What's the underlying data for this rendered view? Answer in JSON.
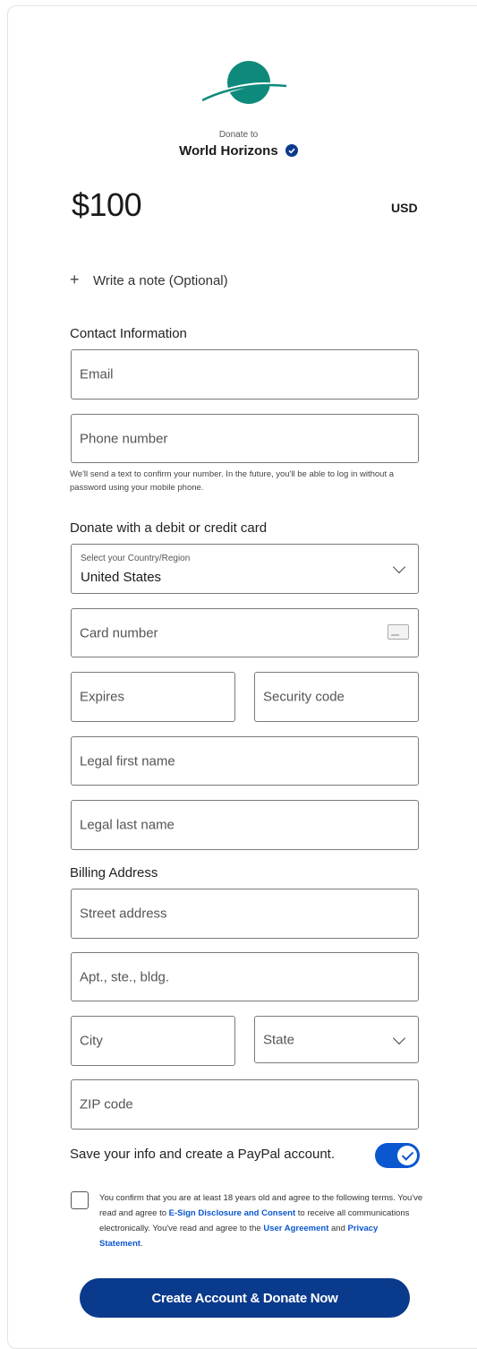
{
  "header": {
    "donate_to_label": "Donate to",
    "org_name": "World Horizons"
  },
  "amount": {
    "value": "$100",
    "currency": "USD"
  },
  "note": {
    "label": "Write a note (Optional)"
  },
  "contact": {
    "section_label": "Contact Information",
    "email_placeholder": "Email",
    "phone_placeholder": "Phone number",
    "helper_text": "We'll send a text to confirm your number. In the future, you'll be able to log in without a password using your mobile phone."
  },
  "card": {
    "section_label": "Donate with a debit or credit card",
    "country_label": "Select your Country/Region",
    "country_value": "United States",
    "card_number_placeholder": "Card number",
    "expires_placeholder": "Expires",
    "security_code_placeholder": "Security code",
    "first_name_placeholder": "Legal first name",
    "last_name_placeholder": "Legal last name"
  },
  "billing": {
    "section_label": "Billing Address",
    "street_placeholder": "Street address",
    "apt_placeholder": "Apt., ste., bldg.",
    "city_placeholder": "City",
    "state_placeholder": "State",
    "zip_placeholder": "ZIP code"
  },
  "account": {
    "save_label": "Save your info and create a PayPal account.",
    "toggle_on": true
  },
  "terms": {
    "part1": "You confirm that you are at least 18 years old and agree to the following terms. You've read and agree to ",
    "link1": "E-Sign Disclosure and Consent",
    "part2": " to receive all communications electronically. You've read and agree to the ",
    "link2": "User Agreement",
    "part3": " and ",
    "link3": "Privacy Statement",
    "part4": "."
  },
  "cta": {
    "label": "Create Account & Donate Now"
  },
  "colors": {
    "brand_teal": "#0e8a7c",
    "accent_blue": "#0b57d0",
    "cta_navy": "#0a3a8c"
  }
}
